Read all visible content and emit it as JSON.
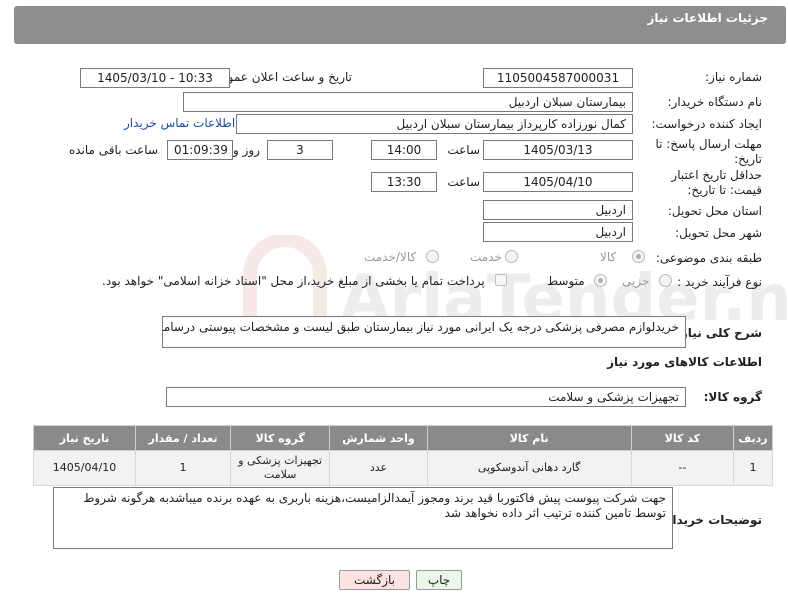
{
  "header": {
    "title": "جزئیات اطلاعات نیاز"
  },
  "fields": {
    "need_number_label": "شماره نیاز:",
    "need_number": "1105004587000031",
    "announce_label": "تاریخ و ساعت اعلان عمومی:",
    "announce_value": "1405/03/10 - 10:33",
    "buyer_org_label": "نام دستگاه خریدار:",
    "buyer_org": "بیمارستان سبلان اردبیل",
    "creator_label": "ایجاد کننده درخواست:",
    "creator": "کمال نورزاده کارپرداز بیمارستان سبلان اردبیل",
    "contact_link": "اطلاعات تماس خریدار",
    "reply_deadline_label": "مهلت ارسال پاسخ: تا تاریخ:",
    "reply_date": "1405/03/13",
    "time_label": "ساعت",
    "reply_time": "14:00",
    "days_value": "3",
    "days_label": "روز و",
    "remaining_time": "01:09:39",
    "remaining_label": "ساعت باقی مانده",
    "price_deadline_label": "حداقل تاریخ اعتبار قیمت: تا تاریخ:",
    "price_date": "1405/04/10",
    "price_time": "13:30",
    "province_label": "استان محل تحویل:",
    "province": "اردبیل",
    "city_label": "شهر محل تحویل:",
    "city": "اردبیل",
    "category_label": "طبقه بندی موضوعی:",
    "category_options": [
      "کالا",
      "خدمت",
      "کالا/خدمت"
    ],
    "process_label": "نوع فرآیند خرید :",
    "process_options": [
      "جزیی",
      "متوسط"
    ],
    "payment_note": "پرداخت تمام یا بخشی از مبلغ خرید،از محل \"اسناد خزانه اسلامی\" خواهد بود.",
    "description_label": "شرح کلی نیاز:",
    "description": "خریدلوازم مصرفی پزشکی درجه یک ایرانی مورد نیاز بیمارستان طبق لیست و مشخصات پیوستی درسامانه"
  },
  "goods": {
    "section_title": "اطلاعات کالاهای مورد نیاز",
    "group_label": "گروه کالا:",
    "group_value": "تجهیزات پزشکی و سلامت",
    "columns": [
      "ردیف",
      "کد کالا",
      "نام کالا",
      "واحد شمارش",
      "گروه کالا",
      "تعداد / مقدار",
      "تاریخ نیاز"
    ],
    "rows": [
      [
        "1",
        "--",
        "گارد دهانی آندوسکوپی",
        "عدد",
        "تجهیزات پزشکی و سلامت",
        "1",
        "1405/04/10"
      ]
    ]
  },
  "buyer_notes": {
    "label": "توضیحات خریدار:",
    "text": "جهت شرکت پیوست پیش فاکتوربا قید برند ومجوز آیمدالزامیست،هزینه باربری به عهده برنده میباشدبه هرگونه شروط توسط تامین کننده ترتیب اثر داده نخواهد شد"
  },
  "buttons": {
    "print": "چاپ",
    "back": "بازگشت"
  },
  "watermark": {
    "text": "AriaTender.net"
  },
  "colors": {
    "header_bg": "#8e8e8e",
    "table_header_bg": "#8a8a8a",
    "link": "#1a4fa8",
    "back_button_bg": "#fde2e2",
    "print_button_bg": "#eaf7e8"
  }
}
